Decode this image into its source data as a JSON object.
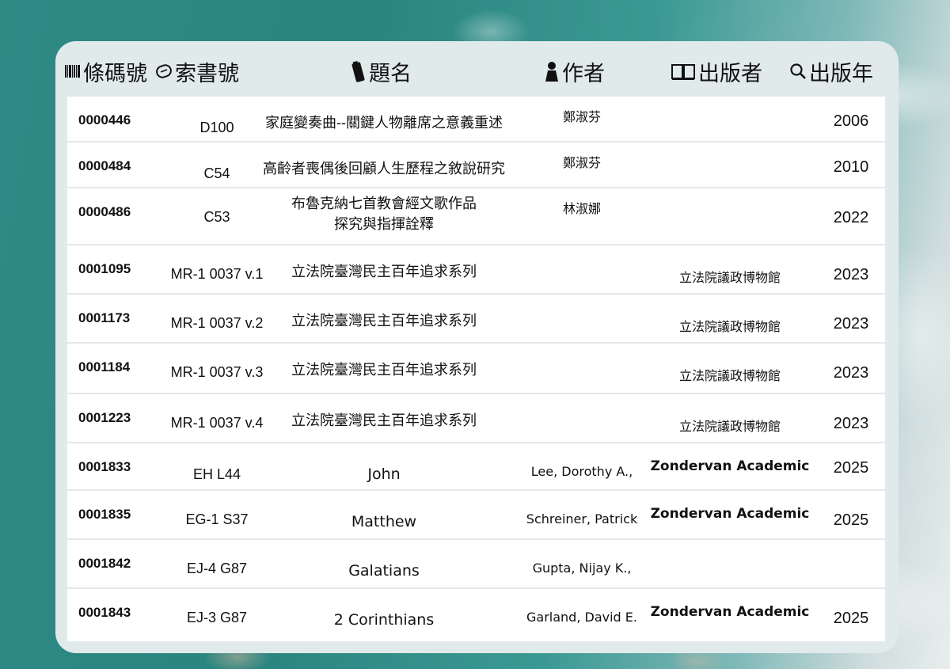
{
  "header": {
    "barcode": "條碼號",
    "callno": "索書號",
    "title": "題名",
    "author": "作者",
    "publisher": "出版者",
    "year": "出版年"
  },
  "icons": {
    "barcode": "barcode-icon",
    "callno": "label-icon",
    "title": "book-spine-icon",
    "author": "person-icon",
    "publisher": "open-book-icon",
    "year": "magnifier-icon"
  },
  "rows": [
    {
      "barcode": "0000446",
      "callno": "D100",
      "title": [
        "家庭變奏曲--關鍵人物離席之意義重述"
      ],
      "author": "鄭淑芬",
      "publisher": "",
      "year": "2006"
    },
    {
      "barcode": "0000484",
      "callno": "C54",
      "title": [
        "高齡者喪偶後回顧人生歷程之敘說研究"
      ],
      "author": "鄭淑芬",
      "publisher": "",
      "year": "2010"
    },
    {
      "barcode": "0000486",
      "callno": "C53",
      "title": [
        "布魯克納七首教會經文歌作品",
        "探究與指揮詮釋"
      ],
      "author": "林淑娜",
      "publisher": "",
      "year": "2022"
    },
    {
      "barcode": "0001095",
      "callno": "MR-1 0037 v.1",
      "title": [
        "立法院臺灣民主百年追求系列"
      ],
      "author": "",
      "publisher": "立法院議政博物館",
      "year": "2023"
    },
    {
      "barcode": "0001173",
      "callno": "MR-1 0037 v.2",
      "title": [
        "立法院臺灣民主百年追求系列"
      ],
      "author": "",
      "publisher": "立法院議政博物館",
      "year": "2023"
    },
    {
      "barcode": "0001184",
      "callno": "MR-1 0037 v.3",
      "title": [
        "立法院臺灣民主百年追求系列"
      ],
      "author": "",
      "publisher": "立法院議政博物館",
      "year": "2023"
    },
    {
      "barcode": "0001223",
      "callno": "MR-1 0037 v.4",
      "title": [
        "立法院臺灣民主百年追求系列"
      ],
      "author": "",
      "publisher": "立法院議政博物館",
      "year": "2023"
    },
    {
      "barcode": "0001833",
      "callno": "EH L44",
      "title": [
        "John"
      ],
      "author": "Lee, Dorothy A.,",
      "publisher": "Zondervan Academic",
      "year": "2025"
    },
    {
      "barcode": "0001835",
      "callno": "EG-1 S37",
      "title": [
        "Matthew"
      ],
      "author": "Schreiner, Patrick",
      "publisher": "Zondervan Academic",
      "year": "2025"
    },
    {
      "barcode": "0001842",
      "callno": "EJ-4 G87",
      "title": [
        "Galatians"
      ],
      "author": "Gupta, Nijay K.,",
      "publisher": "",
      "year": ""
    },
    {
      "barcode": "0001843",
      "callno": "EJ-3 G87",
      "title": [
        "2 Corinthians"
      ],
      "author": "Garland, David E.",
      "publisher": "Zondervan Academic",
      "year": "2025"
    }
  ]
}
